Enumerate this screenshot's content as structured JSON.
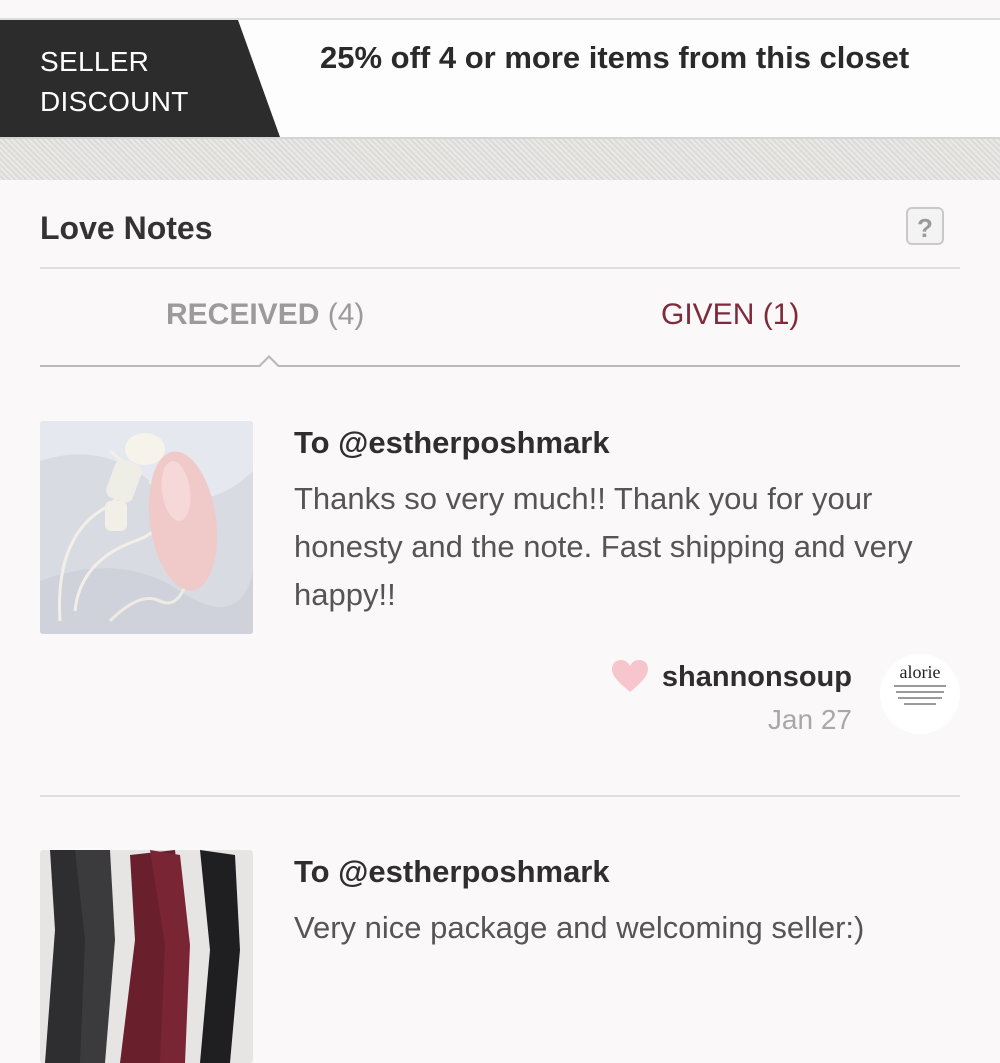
{
  "discount": {
    "tag": "SELLER DISCOUNT",
    "tag_line1": "SELLER",
    "tag_line2": "DISCOUNT",
    "description": "25% off 4 or more items from this closet"
  },
  "love_notes": {
    "title": "Love Notes",
    "help_label": "?",
    "tabs": [
      {
        "label": "RECEIVED",
        "count": "(4)",
        "active": true
      },
      {
        "label": "GIVEN",
        "count": "(1)",
        "active": false
      }
    ],
    "notes": [
      {
        "to": "To @estherposhmark",
        "message": "Thanks so very much!! Thank you for your honesty and the note. Fast shipping and very happy!!",
        "author": "shannonsoup",
        "date": "Jan 27",
        "avatar_text": "alorie",
        "thumbnail": "pink-facial-brush-photo"
      },
      {
        "to": "To @estherposhmark",
        "message": "Very nice package and welcoming seller:)",
        "thumbnail": "tights-photo"
      }
    ]
  },
  "colors": {
    "dark_tag": "#2c2c2c",
    "given_tab": "#7e2a3a",
    "heart": "#f7c6cc"
  }
}
